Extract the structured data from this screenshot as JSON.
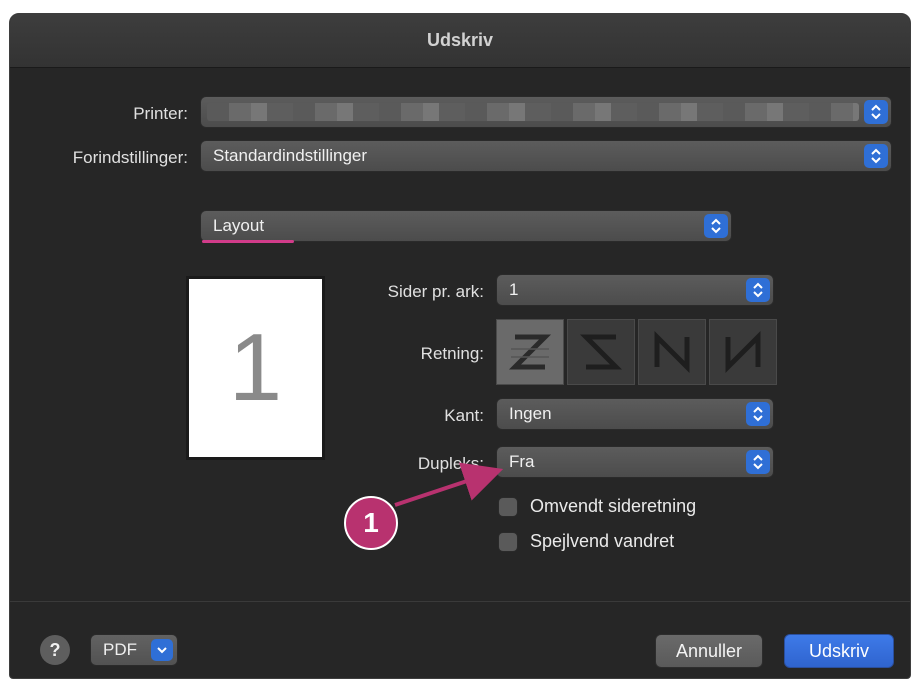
{
  "window": {
    "title": "Udskriv"
  },
  "printer": {
    "label": "Printer:",
    "value": ""
  },
  "presets": {
    "label": "Forindstillinger:",
    "value": "Standardindstillinger"
  },
  "section": {
    "value": "Layout"
  },
  "preview": {
    "page_number": "1"
  },
  "pages_per_sheet": {
    "label": "Sider pr. ark:",
    "value": "1"
  },
  "orientation": {
    "label": "Retning:",
    "options": [
      "z-icon",
      "reverse-z-icon",
      "reverse-n-icon",
      "n-icon"
    ],
    "selected_index": 0
  },
  "border": {
    "label": "Kant:",
    "value": "Ingen"
  },
  "duplex": {
    "label": "Dupleks:",
    "value": "Fra"
  },
  "checkboxes": [
    {
      "label": "Omvendt sideretning",
      "checked": false
    },
    {
      "label": "Spejlvend vandret",
      "checked": false
    }
  ],
  "footer": {
    "help_label": "?",
    "pdf_label": "PDF",
    "cancel_label": "Annuller",
    "print_label": "Udskriv"
  },
  "annotation": {
    "callout_number": "1",
    "color": "#b8326f"
  },
  "colors": {
    "accent": "#2f6fd6",
    "highlight": "#d23c8a"
  }
}
